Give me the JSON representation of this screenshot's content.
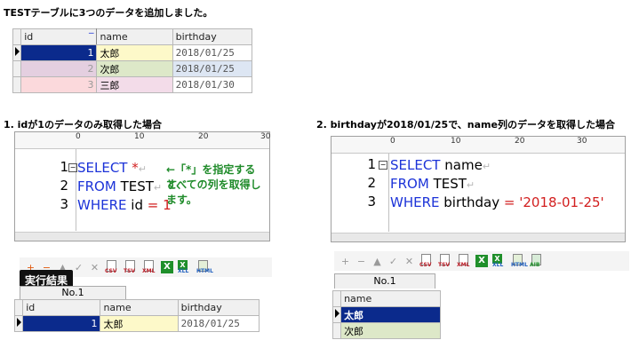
{
  "intro": "TESTテーブルに3つのデータを追加しました。",
  "table": {
    "columns": [
      "id",
      "name",
      "birthday"
    ],
    "rows": [
      {
        "id": "1",
        "name": "太郎",
        "birthday": "2018/01/25"
      },
      {
        "id": "2",
        "name": "次郎",
        "birthday": "2018/01/25"
      },
      {
        "id": "3",
        "name": "三郎",
        "birthday": "2018/01/30"
      }
    ]
  },
  "example1": {
    "heading": "1. idが1のデータのみ取得した場合",
    "ruler": [
      "0",
      "10",
      "20",
      "30"
    ],
    "line_numbers": [
      "1",
      "2",
      "3"
    ],
    "sql": {
      "select": "SELECT",
      "star": "*",
      "from": "FROM",
      "table": "TEST",
      "where": "WHERE",
      "col": "id",
      "op": "=",
      "val": "1"
    },
    "note1": "←「*」を指定すると、",
    "note2": "すべての列を取得します。",
    "result_badge": "実行結果",
    "tab_label": "No.1",
    "result": {
      "columns": [
        "id",
        "name",
        "birthday"
      ],
      "row": {
        "id": "1",
        "name": "太郎",
        "birthday": "2018/01/25"
      }
    }
  },
  "example2": {
    "heading": "2. birthdayが2018/01/25で、name列のデータを取得した場合",
    "ruler": [
      "0",
      "10",
      "20",
      "30"
    ],
    "line_numbers": [
      "1",
      "2",
      "3"
    ],
    "sql": {
      "select": "SELECT",
      "col": "name",
      "from": "FROM",
      "table": "TEST",
      "where": "WHERE",
      "wcol": "birthday",
      "op": "=",
      "val": "'2018-01-25'"
    },
    "tab_label": "No.1",
    "result": {
      "columns": [
        "name"
      ],
      "rows": [
        "太郎",
        "次郎"
      ]
    }
  },
  "toolbar": {
    "buttons": [
      "+",
      "−",
      "▲",
      "✓",
      "✕"
    ],
    "exports": [
      "CSV",
      "TSV",
      "XML",
      "X",
      "XLL",
      "HTML",
      "AIB"
    ]
  },
  "colors": {
    "keyword": "#1c33d8",
    "string": "#d21f1f",
    "note": "#1f8b2a",
    "selected": "#0b2a8c",
    "row_name_1": "#fdf9c9",
    "row_name_2": "#dde8c8",
    "row_name_3": "#f3dce9"
  }
}
